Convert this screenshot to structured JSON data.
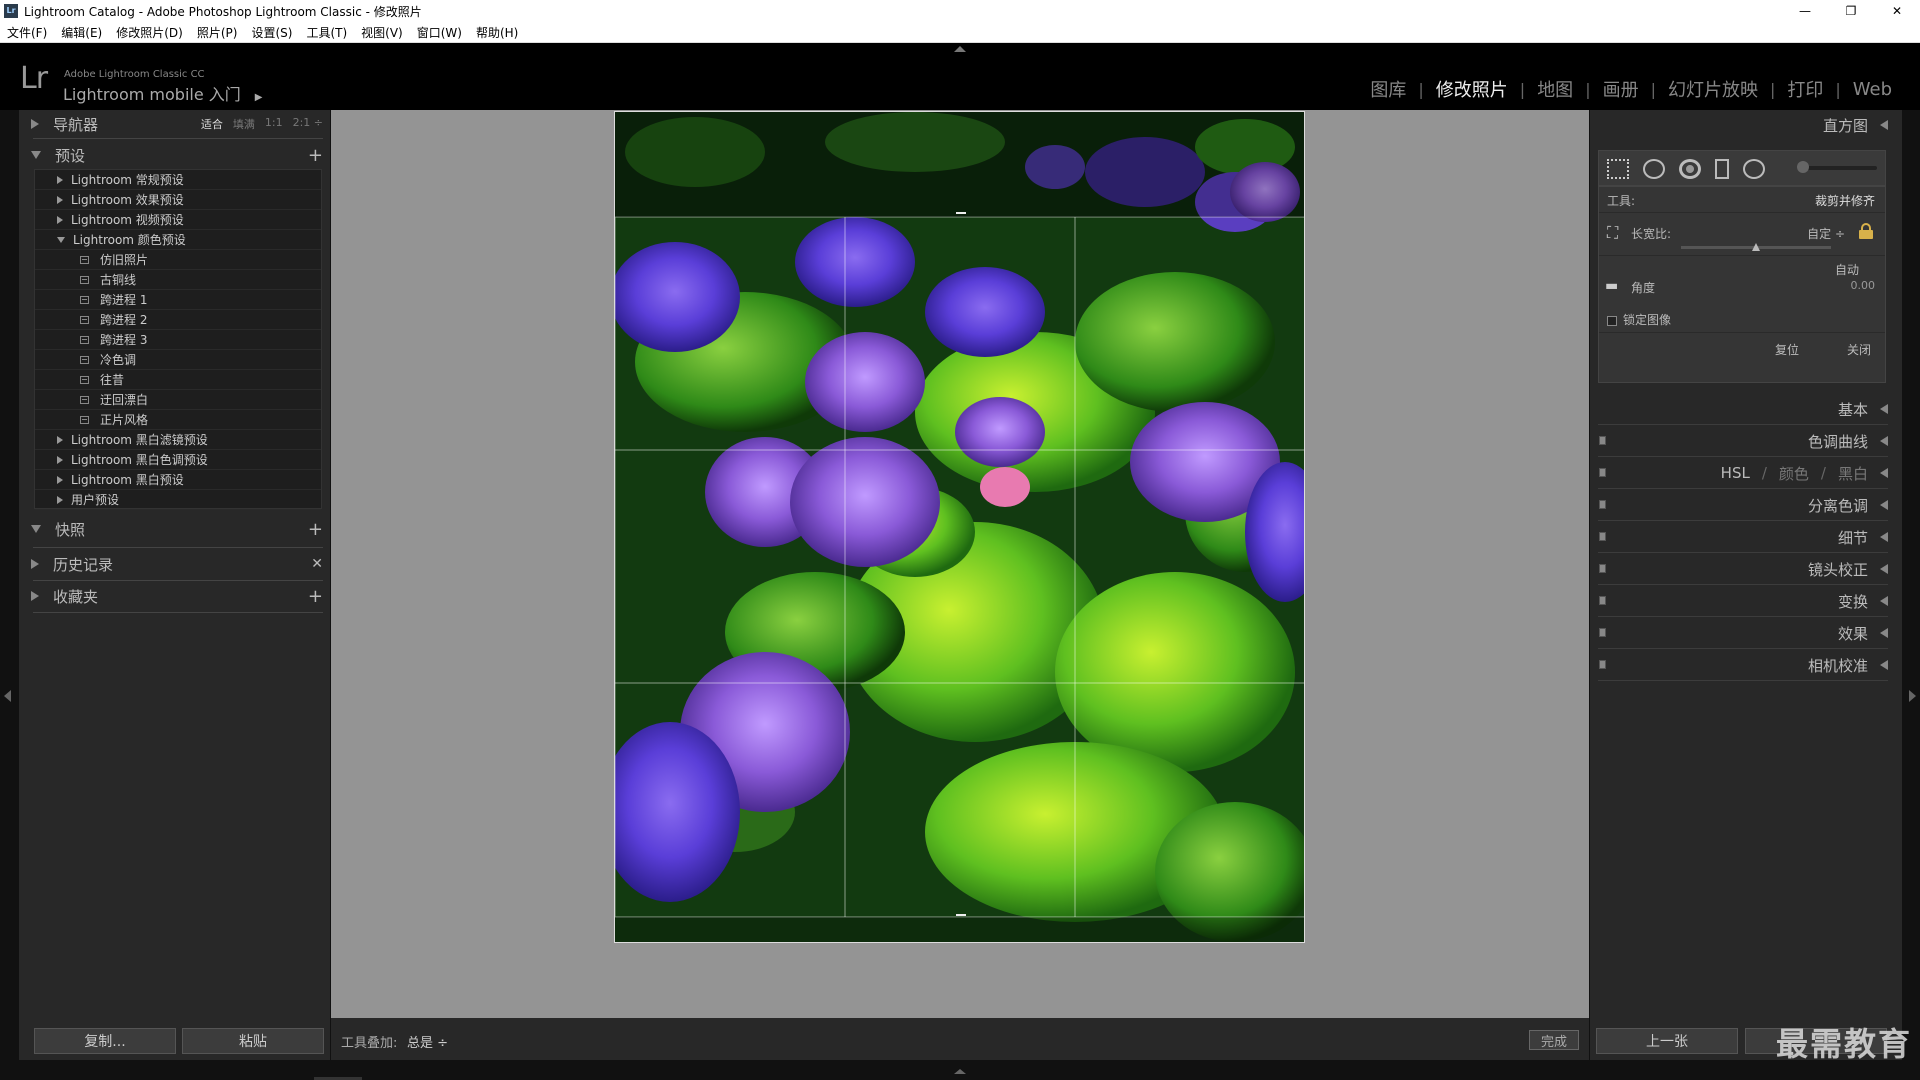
{
  "window": {
    "icon_text": "Lr",
    "title": "Lightroom Catalog - Adobe Photoshop Lightroom Classic - 修改照片",
    "controls": [
      "—",
      "❐",
      "✕"
    ]
  },
  "menu": [
    "文件(F)",
    "编辑(E)",
    "修改照片(D)",
    "照片(P)",
    "设置(S)",
    "工具(T)",
    "视图(V)",
    "窗口(W)",
    "帮助(H)"
  ],
  "identity": {
    "logo": "Lr",
    "product_small": "Adobe Lightroom Classic CC",
    "product_big": "Lightroom mobile 入门",
    "modules": [
      "图库",
      "修改照片",
      "地图",
      "画册",
      "幻灯片放映",
      "打印",
      "Web"
    ],
    "active_module": "修改照片"
  },
  "left_panel": {
    "navigator": {
      "title": "导航器",
      "zoom": [
        "适合",
        "填满",
        "1:1",
        "2:1 ÷"
      ],
      "active_zoom": "适合"
    },
    "presets": {
      "title": "预设",
      "items": [
        {
          "label": "Lightroom 常规预设",
          "type": "folder",
          "open": false
        },
        {
          "label": "Lightroom 效果预设",
          "type": "folder",
          "open": false
        },
        {
          "label": "Lightroom 视频预设",
          "type": "folder",
          "open": false
        },
        {
          "label": "Lightroom 颜色预设",
          "type": "folder",
          "open": true
        },
        {
          "label": "仿旧照片",
          "type": "preset"
        },
        {
          "label": "古铜线",
          "type": "preset"
        },
        {
          "label": "跨进程 1",
          "type": "preset"
        },
        {
          "label": "跨进程 2",
          "type": "preset"
        },
        {
          "label": "跨进程 3",
          "type": "preset"
        },
        {
          "label": "冷色调",
          "type": "preset"
        },
        {
          "label": "往昔",
          "type": "preset"
        },
        {
          "label": "迂回漂白",
          "type": "preset"
        },
        {
          "label": "正片风格",
          "type": "preset"
        },
        {
          "label": "Lightroom 黑白滤镜预设",
          "type": "folder",
          "open": false
        },
        {
          "label": "Lightroom 黑白色调预设",
          "type": "folder",
          "open": false
        },
        {
          "label": "Lightroom 黑白预设",
          "type": "folder",
          "open": false
        },
        {
          "label": "用户预设",
          "type": "folder",
          "open": false
        }
      ]
    },
    "snapshots": {
      "title": "快照"
    },
    "history": {
      "title": "历史记录"
    },
    "collections": {
      "title": "收藏夹"
    },
    "copy_label": "复制...",
    "paste_label": "粘贴"
  },
  "toolbar": {
    "overlay_label": "工具叠加:",
    "overlay_value": "总是 ÷",
    "done_label": "完成"
  },
  "right_panel": {
    "histogram": "直方图",
    "crop": {
      "tool_label": "工具:",
      "tool_value": "裁剪并修齐",
      "aspect_label": "长宽比:",
      "aspect_value": "自定 ÷",
      "auto_label": "自动",
      "angle_label": "角度",
      "angle_value": "0.00",
      "constrain_label": "锁定图像",
      "reset_label": "复位",
      "close_label": "关闭"
    },
    "sections": [
      "基本",
      "色调曲线",
      "分离色调",
      "细节",
      "镜头校正",
      "变换",
      "效果",
      "相机校准"
    ],
    "hsl": [
      "HSL",
      "颜色",
      "黑白"
    ],
    "prev_label": "上一张"
  },
  "watermark": "最需教育"
}
